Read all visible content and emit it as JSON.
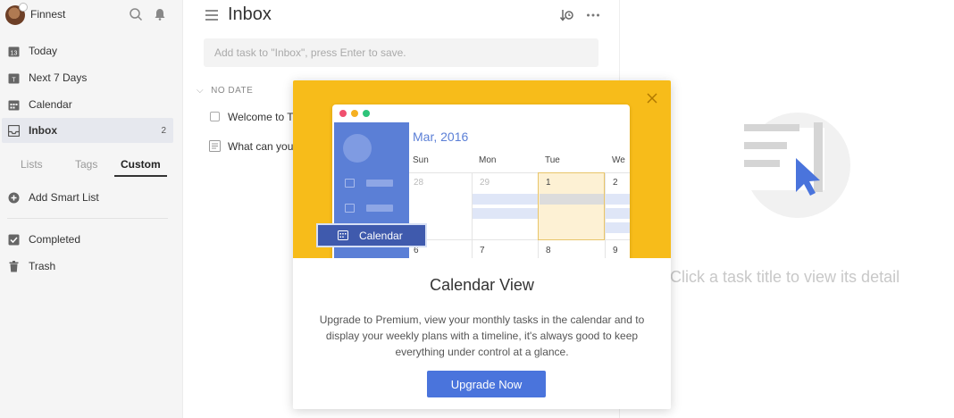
{
  "profile": {
    "name": "Finnest"
  },
  "sidebar": {
    "items": [
      {
        "label": "Today",
        "icon": "calendar-13-icon"
      },
      {
        "label": "Next 7 Days",
        "icon": "calendar-t-icon"
      },
      {
        "label": "Calendar",
        "icon": "calendar-grid-icon"
      },
      {
        "label": "Inbox",
        "icon": "inbox-icon",
        "count": "2",
        "active": true
      }
    ],
    "tabs": [
      {
        "label": "Lists"
      },
      {
        "label": "Tags"
      },
      {
        "label": "Custom",
        "active": true
      }
    ],
    "add_smart_list": "Add Smart List",
    "bottom_items": [
      {
        "label": "Completed",
        "icon": "checkbox-icon"
      },
      {
        "label": "Trash",
        "icon": "trash-icon"
      }
    ]
  },
  "main": {
    "title": "Inbox",
    "add_task_placeholder": "Add task to \"Inbox\", press Enter to save.",
    "section": "NO DATE",
    "tasks": [
      {
        "label": "Welcome to T",
        "type": "checkbox"
      },
      {
        "label": "What can you",
        "type": "note"
      }
    ]
  },
  "detail": {
    "hint": "Click a task title to view its detail"
  },
  "modal": {
    "title": "Calendar View",
    "description": "Upgrade to Premium, view your monthly tasks in the calendar and to display your weekly plans with a timeline, it's always good to keep everything under control at a glance.",
    "button": "Upgrade Now",
    "mock": {
      "month": "Mar, 2016",
      "days": [
        "Sun",
        "Mon",
        "Tue",
        "We"
      ],
      "row1": [
        "28",
        "29",
        "1",
        "2"
      ],
      "row2": [
        "6",
        "7",
        "8",
        "9"
      ],
      "pill_label": "Calendar"
    }
  },
  "colors": {
    "accent": "#4a74dc",
    "banner": "#f7bc1a",
    "sidebar_bg": "#f5f5f5",
    "active_bg": "#e6e8ee"
  }
}
